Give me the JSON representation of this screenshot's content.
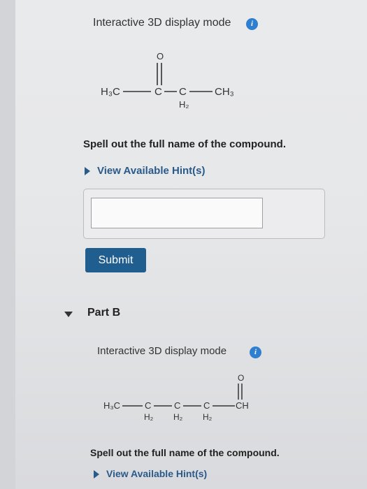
{
  "part_a": {
    "mode_label": "Interactive 3D display mode",
    "info_icon": "i",
    "structure": {
      "left": "H₃C",
      "middle": "C",
      "methylene": "C",
      "right": "CH₃",
      "sub": "H₂",
      "oxygen": "O"
    },
    "question": "Spell out the full name of the compound.",
    "hint": "View Available Hint(s)",
    "answer_value": "",
    "submit_label": "Submit"
  },
  "part_b": {
    "title": "Part B",
    "mode_label": "Interactive 3D display mode",
    "info_icon": "i",
    "structure": {
      "left": "H₃C",
      "c1": "C",
      "c2": "C",
      "c3": "C",
      "right": "CH",
      "sub1": "H₂",
      "sub2": "H₂",
      "sub3": "H₂",
      "oxygen": "O"
    },
    "question": "Spell out the full name of the compound.",
    "hint": "View Available Hint(s)"
  }
}
